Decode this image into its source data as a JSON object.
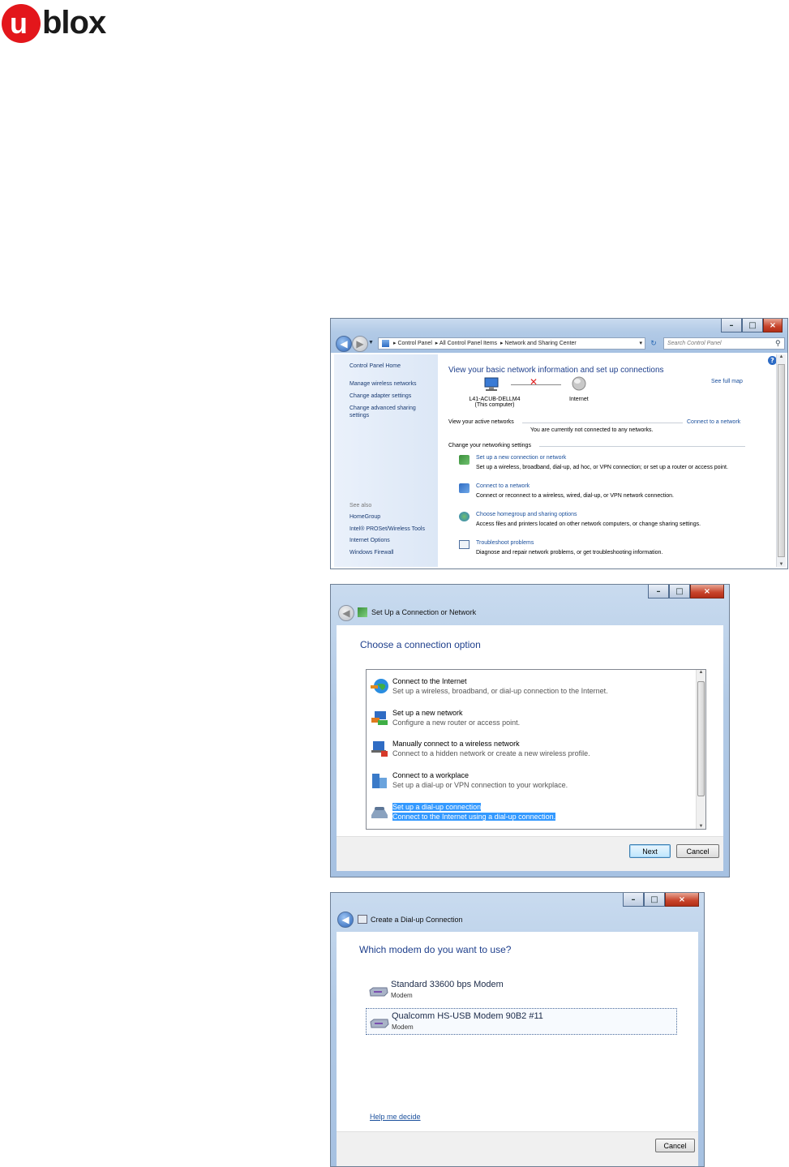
{
  "logo": {
    "u": "u",
    "rest": "blox"
  },
  "window1": {
    "address": [
      "Control Panel",
      "All Control Panel Items",
      "Network and Sharing Center"
    ],
    "search_placeholder": "Search Control Panel",
    "sidebar": {
      "home": "Control Panel Home",
      "items": [
        "Manage wireless networks",
        "Change adapter settings",
        "Change advanced sharing settings"
      ],
      "see_also_label": "See also",
      "see_also": [
        "HomeGroup",
        "Intel® PROSet/Wireless Tools",
        "Internet Options",
        "Windows Firewall"
      ]
    },
    "heading": "View your basic network information and set up connections",
    "see_full_map": "See full map",
    "computer_name": "L41-ACUB-DELLM4",
    "computer_sub": "(This computer)",
    "internet": "Internet",
    "active_networks_label": "View your active networks",
    "connect_link": "Connect to a network",
    "not_connected": "You are currently not connected to any networks.",
    "settings_label": "Change your networking settings",
    "tasks": [
      {
        "title": "Set up a new connection or network",
        "desc": "Set up a wireless, broadband, dial-up, ad hoc, or VPN connection; or set up a router or access point."
      },
      {
        "title": "Connect to a network",
        "desc": "Connect or reconnect to a wireless, wired, dial-up, or VPN network connection."
      },
      {
        "title": "Choose homegroup and sharing options",
        "desc": "Access files and printers located on other network computers, or change sharing settings."
      },
      {
        "title": "Troubleshoot problems",
        "desc": "Diagnose and repair network problems, or get troubleshooting information."
      }
    ]
  },
  "window2": {
    "title": "Set Up a Connection or Network",
    "heading": "Choose a connection option",
    "options": [
      {
        "title": "Connect to the Internet",
        "desc": "Set up a wireless, broadband, or dial-up connection to the Internet."
      },
      {
        "title": "Set up a new network",
        "desc": "Configure a new router or access point."
      },
      {
        "title": "Manually connect to a wireless network",
        "desc": "Connect to a hidden network or create a new wireless profile."
      },
      {
        "title": "Connect to a workplace",
        "desc": "Set up a dial-up or VPN connection to your workplace."
      },
      {
        "title": "Set up a dial-up connection",
        "desc": "Connect to the Internet using a dial-up connection."
      }
    ],
    "next_label": "Next",
    "cancel_label": "Cancel"
  },
  "window3": {
    "title": "Create a Dial-up Connection",
    "heading": "Which modem do you want to use?",
    "modems": [
      {
        "name": "Standard 33600 bps Modem",
        "type": "Modem"
      },
      {
        "name": "Qualcomm HS-USB Modem 90B2 #11",
        "type": "Modem"
      }
    ],
    "help_link": "Help me decide",
    "cancel_label": "Cancel"
  },
  "colors": {
    "accent_link": "#1a4f9c",
    "heading_blue": "#1e3f8c",
    "selection": "#3399ff",
    "brand_red": "#e3161b"
  }
}
